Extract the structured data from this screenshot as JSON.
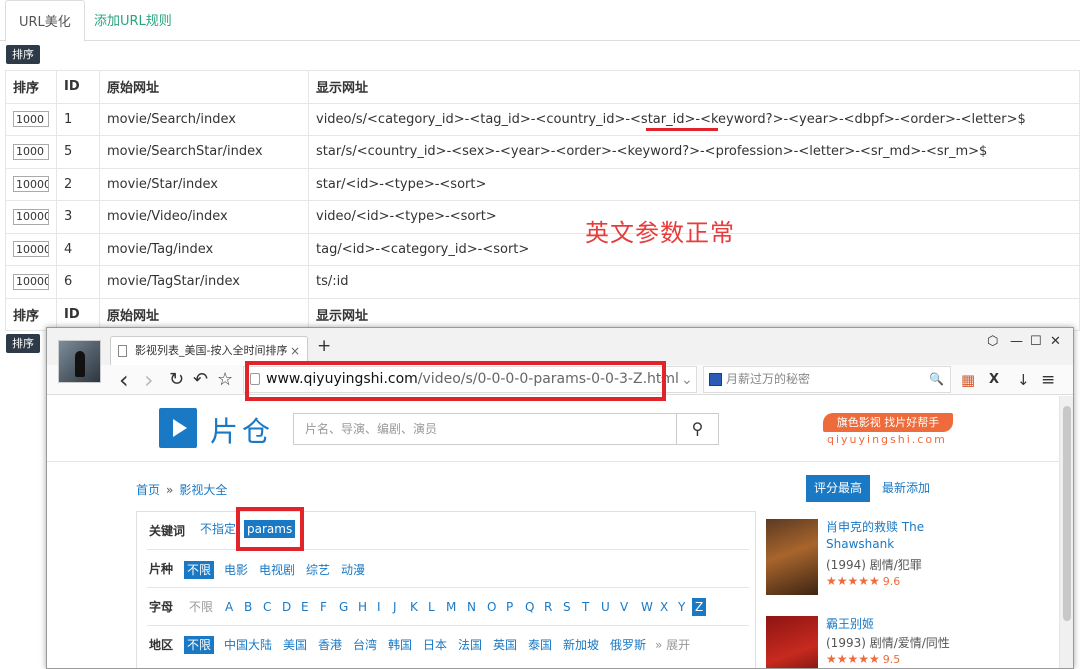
{
  "admin": {
    "tabs": [
      "URL美化",
      "添加URL规则"
    ],
    "sort_button": "排序",
    "columns": [
      "排序",
      "ID",
      "原始网址",
      "显示网址"
    ],
    "rows": [
      {
        "sort": "1000",
        "id": "1",
        "original": "movie/Search/index",
        "display": "video/s/<category_id>-<tag_id>-<country_id>-<star_id>-<keyword?>-<year>-<dbpf>-<order>-<letter>$"
      },
      {
        "sort": "1000",
        "id": "5",
        "original": "movie/SearchStar/index",
        "display": "star/s/<country_id>-<sex>-<year>-<order>-<keyword?>-<profession>-<letter>-<sr_md>-<sr_m>$"
      },
      {
        "sort": "10000",
        "id": "2",
        "original": "movie/Star/index",
        "display": "star/<id>-<type>-<sort>"
      },
      {
        "sort": "10000",
        "id": "3",
        "original": "movie/Video/index",
        "display": "video/<id>-<type>-<sort>"
      },
      {
        "sort": "10000",
        "id": "4",
        "original": "movie/Tag/index",
        "display": "tag/<id>-<category_id>-<sort>"
      },
      {
        "sort": "10000",
        "id": "6",
        "original": "movie/TagStar/index",
        "display": "ts/:id"
      }
    ],
    "annotation": "英文参数正常",
    "annotation_color": "#e83c3c",
    "highlight_color": "#e0242a"
  },
  "browser": {
    "tab_title": "影视列表_美国-按入全时间排序",
    "tab_close": "×",
    "new_tab": "+",
    "window_controls": [
      "⬡",
      "—",
      "☐",
      "✕"
    ],
    "nav": {
      "back": "‹",
      "forward": "›",
      "reload": "↻",
      "undo": "↶",
      "star": "☆"
    },
    "url_host": "www.qiyuyingshi.com",
    "url_path": "/video/s/0-0-0-0-params-0-0-3-Z.html",
    "search_placeholder": "月薪过万的秘密",
    "toolbar_icons": [
      "⚡",
      "⌄",
      "🔍",
      "▦",
      "X",
      "↓",
      "≡"
    ]
  },
  "site": {
    "logo": "片仓",
    "search_placeholder": "片名、导演、编剧、演员",
    "search_icon": "⚲",
    "promo": "旗色影视 找片好帮手",
    "promo_domain": "qiyuyingshi.com",
    "breadcrumb": [
      "首页",
      "»",
      "影视大全"
    ],
    "sort_tabs": [
      "评分最高",
      "最新添加"
    ],
    "filters": {
      "keyword": {
        "label": "关键词",
        "options": [
          "不指定",
          "params"
        ]
      },
      "type": {
        "label": "片种",
        "options": [
          "不限",
          "电影",
          "电视剧",
          "综艺",
          "动漫"
        ]
      },
      "letter": {
        "label": "字母",
        "options": [
          "不限",
          "A",
          "B",
          "C",
          "D",
          "E",
          "F",
          "G",
          "H",
          "I",
          "J",
          "K",
          "L",
          "M",
          "N",
          "O",
          "P",
          "Q",
          "R",
          "S",
          "T",
          "U",
          "V",
          "W",
          "X",
          "Y",
          "Z"
        ]
      },
      "region": {
        "label": "地区",
        "options": [
          "不限",
          "中国大陆",
          "美国",
          "香港",
          "台湾",
          "韩国",
          "日本",
          "法国",
          "英国",
          "泰国",
          "新加坡",
          "俄罗斯"
        ],
        "expand": "» 展开"
      }
    },
    "movies": [
      {
        "title": "肖申克的救赎 The Shawshank",
        "info": "(1994) 剧情/犯罪",
        "stars": "★★★★★",
        "score": "9.6"
      },
      {
        "title": "霸王别姬",
        "info": "(1993) 剧情/爱情/同性",
        "stars": "★★★★★",
        "score": "9.5"
      }
    ]
  }
}
